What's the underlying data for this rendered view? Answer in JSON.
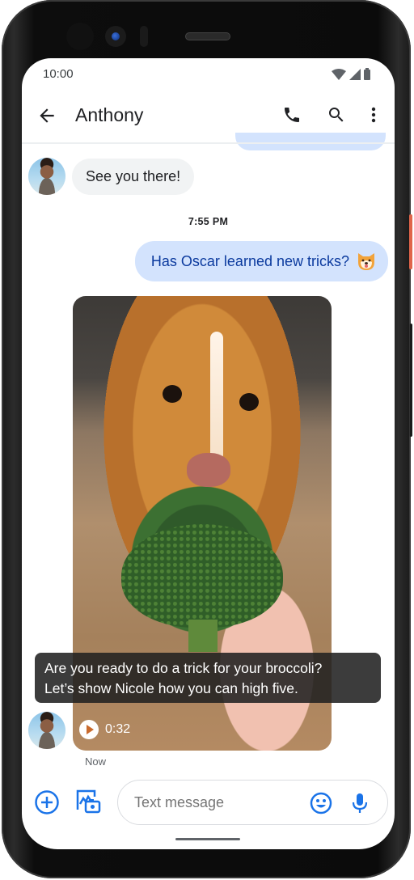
{
  "status_bar": {
    "time": "10:00",
    "icons": [
      "wifi-icon",
      "cellular-signal-icon",
      "battery-icon"
    ]
  },
  "app_bar": {
    "title": "Anthony",
    "back_icon": "arrow-back-icon",
    "actions": [
      "phone-call-icon",
      "search-icon",
      "more-vert-icon"
    ]
  },
  "conversation": {
    "messages": [
      {
        "direction": "incoming",
        "sender": "Anthony",
        "text": "See you there!"
      },
      {
        "type": "timestamp",
        "text": "7:55 PM"
      },
      {
        "direction": "outgoing",
        "text": "Has Oscar learned new tricks?",
        "emoji": "shiba-dog-emoji"
      },
      {
        "direction": "incoming",
        "sender": "Anthony",
        "type": "video",
        "subject": "Dog looking at broccoli",
        "caption_line1": "Are you ready to do a trick for your broccoli?",
        "caption_line2": "Let’s show Nicole how you can high five.",
        "duration": "0:32",
        "time": "Now"
      }
    ]
  },
  "composer": {
    "placeholder": "Text message",
    "value": "",
    "buttons": [
      "add-icon",
      "gallery-camera-icon",
      "emoji-icon",
      "microphone-icon"
    ]
  },
  "colors": {
    "accent": "#1a73e8",
    "outgoing_bubble": "#d3e3fd",
    "outgoing_text": "#0b3a9e",
    "incoming_bubble": "#f1f3f4",
    "power_button": "#e0654a"
  }
}
